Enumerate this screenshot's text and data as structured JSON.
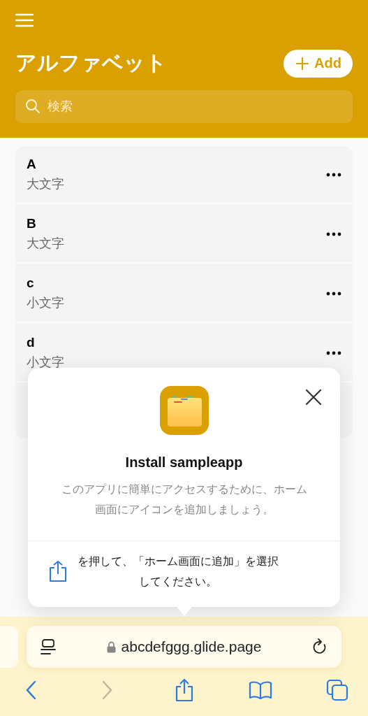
{
  "header": {
    "title": "アルファベット",
    "add_button": "Add",
    "search": {
      "placeholder": "検索"
    }
  },
  "list": [
    {
      "title": "A",
      "subtitle": "大文字"
    },
    {
      "title": "B",
      "subtitle": "大文字"
    },
    {
      "title": "c",
      "subtitle": "小文字"
    },
    {
      "title": "d",
      "subtitle": "小文字"
    }
  ],
  "install_popup": {
    "title": "Install sampleapp",
    "message": "このアプリに簡単にアクセスするために、ホーム画面にアイコンを追加しましょう。",
    "instruction": "を押して、「ホーム画面に追加」を選択してください。"
  },
  "browser": {
    "url": "abcdefggg.glide.page",
    "toolbar": [
      {
        "kind": "back",
        "disabled": false
      },
      {
        "kind": "forward",
        "disabled": true
      },
      {
        "kind": "share",
        "disabled": false
      },
      {
        "kind": "bookmarks",
        "disabled": false
      },
      {
        "kind": "tabs",
        "disabled": false
      }
    ]
  }
}
